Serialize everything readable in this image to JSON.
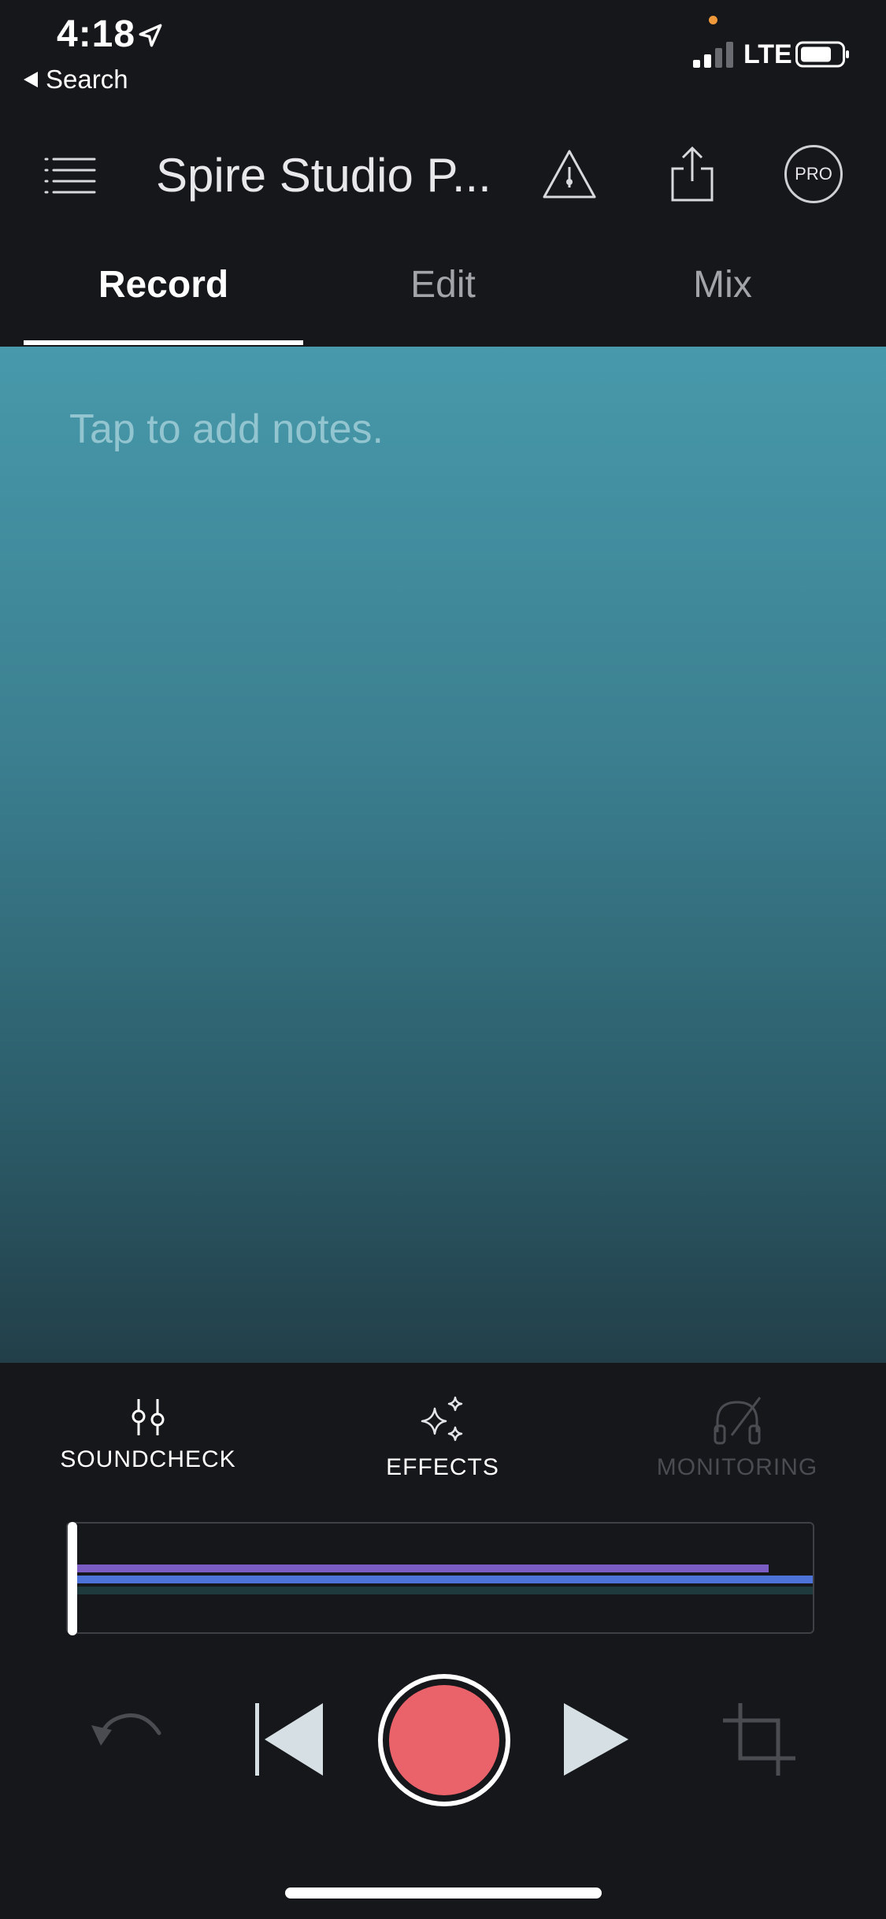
{
  "status_bar": {
    "time": "4:18",
    "back_label": "Search",
    "carrier": "LTE",
    "icons": [
      "location-arrow-icon",
      "signal-icon",
      "battery-icon"
    ]
  },
  "header": {
    "title": "Spire Studio P...",
    "icons": [
      "menu-icon",
      "warning-icon",
      "share-icon"
    ],
    "pro_label": "PRO"
  },
  "tabs": [
    {
      "label": "Record",
      "active": true
    },
    {
      "label": "Edit",
      "active": false
    },
    {
      "label": "Mix",
      "active": false
    }
  ],
  "notes": {
    "placeholder": "Tap to add notes."
  },
  "tools": [
    {
      "label": "SOUNDCHECK",
      "icon": "sliders-icon",
      "enabled": true
    },
    {
      "label": "EFFECTS",
      "icon": "sparkles-icon",
      "enabled": true
    },
    {
      "label": "MONITORING",
      "icon": "headphones-off-icon",
      "enabled": false
    }
  ],
  "timeline": {
    "tracks": [
      {
        "color": "#7b5cc2",
        "length_fraction": 0.94
      },
      {
        "color": "#4d73d8",
        "length_fraction": 1.0
      },
      {
        "color": "#1f3a3c",
        "length_fraction": 1.0
      }
    ]
  },
  "transport": {
    "icons": [
      "undo-icon",
      "skip-back-icon",
      "record-icon",
      "play-icon",
      "crop-icon"
    ],
    "record_color": "#ea636b"
  }
}
